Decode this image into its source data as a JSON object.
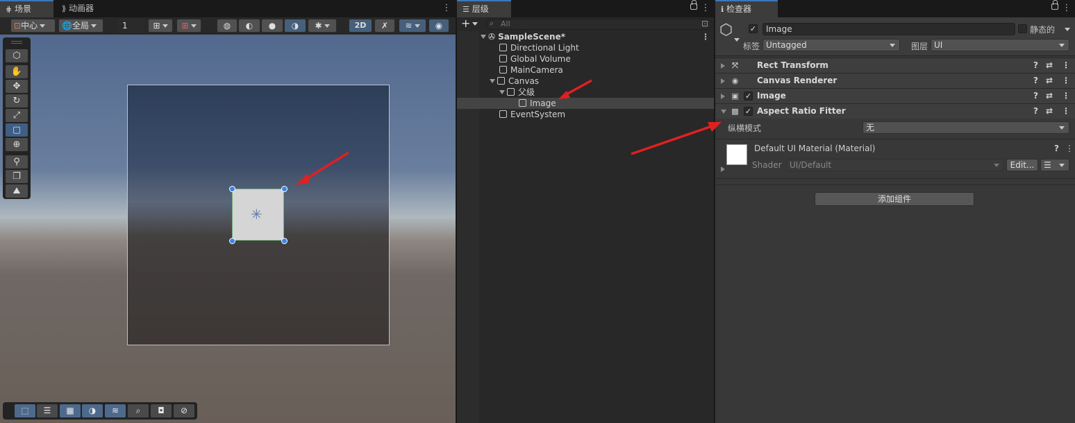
{
  "scene": {
    "tabs": [
      {
        "label": "场景"
      },
      {
        "label": "动画器"
      }
    ],
    "toolbar": {
      "pivot": "中心",
      "global": "全局",
      "grid_value": "1",
      "mode_2d": "2D"
    }
  },
  "hierarchy": {
    "tab": "层级",
    "search_placeholder": "All",
    "rows": [
      {
        "label": "SampleScene*"
      },
      {
        "label": "Directional Light"
      },
      {
        "label": "Global Volume"
      },
      {
        "label": "MainCamera"
      },
      {
        "label": "Canvas"
      },
      {
        "label": "父级"
      },
      {
        "label": "Image"
      },
      {
        "label": "EventSystem"
      }
    ]
  },
  "inspector": {
    "tab": "检查器",
    "object_name": "Image",
    "static_label": "静态的",
    "tag_label": "标签",
    "tag_value": "Untagged",
    "layer_label": "图层",
    "layer_value": "UI",
    "components": [
      {
        "name": "Rect Transform"
      },
      {
        "name": "Canvas Renderer"
      },
      {
        "name": "Image"
      },
      {
        "name": "Aspect Ratio Fitter"
      }
    ],
    "aspect_mode_label": "纵横模式",
    "aspect_mode_value": "无",
    "material_name": "Default UI Material (Material)",
    "shader_label": "Shader",
    "shader_value": "UI/Default",
    "edit_button": "Edit...",
    "add_component": "添加组件"
  },
  "colors": {
    "annotation_arrow": "#e02020",
    "selection_blue": "#3a79bb"
  }
}
